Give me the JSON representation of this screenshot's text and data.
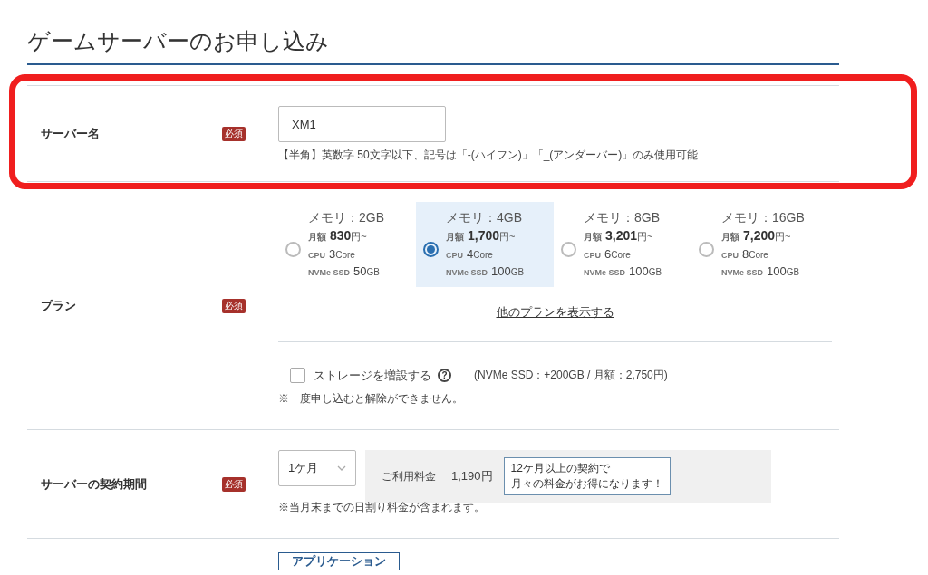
{
  "title": "ゲームサーバーのお申し込み",
  "highlight": {
    "on": true
  },
  "server_name": {
    "label": "サーバー名",
    "badge": "必須",
    "value": "XM1",
    "hint": "【半角】英数字 50文字以下、記号は「-(ハイフン)」「_(アンダーバー)」のみ使用可能"
  },
  "plan": {
    "label": "プラン",
    "badge": "必須",
    "options": [
      {
        "memory": "メモリ：2GB",
        "price_label": "月額",
        "price": "830",
        "price_unit": "円~",
        "cpu_label": "CPU",
        "cpu": "3",
        "cpu_unit": "Core",
        "ssd_label": "NVMe SSD",
        "ssd": "50",
        "ssd_unit": "GB",
        "selected": false
      },
      {
        "memory": "メモリ：4GB",
        "price_label": "月額",
        "price": "1,700",
        "price_unit": "円~",
        "cpu_label": "CPU",
        "cpu": "4",
        "cpu_unit": "Core",
        "ssd_label": "NVMe SSD",
        "ssd": "100",
        "ssd_unit": "GB",
        "selected": true
      },
      {
        "memory": "メモリ：8GB",
        "price_label": "月額",
        "price": "3,201",
        "price_unit": "円~",
        "cpu_label": "CPU",
        "cpu": "6",
        "cpu_unit": "Core",
        "ssd_label": "NVMe SSD",
        "ssd": "100",
        "ssd_unit": "GB",
        "selected": false
      },
      {
        "memory": "メモリ：16GB",
        "price_label": "月額",
        "price": "7,200",
        "price_unit": "円~",
        "cpu_label": "CPU",
        "cpu": "8",
        "cpu_unit": "Core",
        "ssd_label": "NVMe SSD",
        "ssd": "100",
        "ssd_unit": "GB",
        "selected": false
      }
    ],
    "more_link": "他のプランを表示する",
    "storage": {
      "label": "ストレージを増設する",
      "checked": false,
      "help": "?",
      "detail": "(NVMe SSD：+200GB / 月額：2,750円)"
    },
    "note": "※一度申し込むと解除ができません。"
  },
  "period": {
    "label": "サーバーの契約期間",
    "badge": "必須",
    "value": "1ケ月",
    "fee_label": "ご利用料金",
    "fee": "1,190円",
    "tip": [
      "12ケ月以上の契約で",
      "月々の料金がお得になります！"
    ],
    "note": "※当月末までの日割り料金が含まれます。"
  },
  "next_button": "アプリケーション"
}
